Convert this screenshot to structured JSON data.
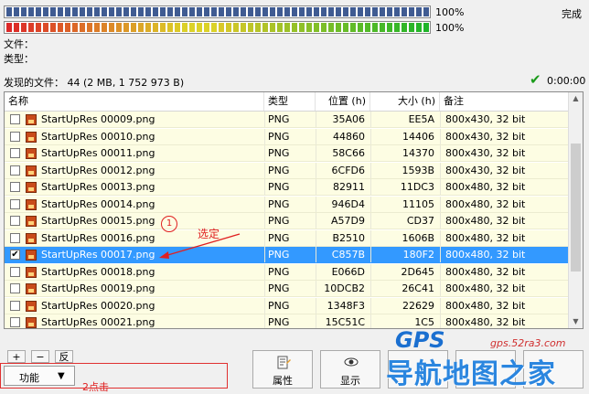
{
  "progress": {
    "bar1_percent": "100%",
    "bar2_percent": "100%",
    "status": "完成",
    "bar1_value": 1.0,
    "bar2_value": 1.0
  },
  "info": {
    "file_label": "文件：",
    "type_label": "类型：",
    "found": "发现的文件： 44 (2 MB, 1 752 973 B)",
    "timer": "0:00:00"
  },
  "table": {
    "headers": {
      "name": "名称",
      "type": "类型",
      "pos": "位置 (h)",
      "size": "大小 (h)",
      "note": "备注"
    },
    "rows": [
      {
        "name": "StartUpRes 00009.png",
        "type": "PNG",
        "pos": "35A06",
        "size": "EE5A",
        "note": "800x430, 32 bit",
        "checked": false,
        "selected": false
      },
      {
        "name": "StartUpRes 00010.png",
        "type": "PNG",
        "pos": "44860",
        "size": "14406",
        "note": "800x430, 32 bit",
        "checked": false,
        "selected": false
      },
      {
        "name": "StartUpRes 00011.png",
        "type": "PNG",
        "pos": "58C66",
        "size": "14370",
        "note": "800x430, 32 bit",
        "checked": false,
        "selected": false
      },
      {
        "name": "StartUpRes 00012.png",
        "type": "PNG",
        "pos": "6CFD6",
        "size": "1593B",
        "note": "800x430, 32 bit",
        "checked": false,
        "selected": false
      },
      {
        "name": "StartUpRes 00013.png",
        "type": "PNG",
        "pos": "82911",
        "size": "11DC3",
        "note": "800x480, 32 bit",
        "checked": false,
        "selected": false
      },
      {
        "name": "StartUpRes 00014.png",
        "type": "PNG",
        "pos": "946D4",
        "size": "11105",
        "note": "800x480, 32 bit",
        "checked": false,
        "selected": false
      },
      {
        "name": "StartUpRes 00015.png",
        "type": "PNG",
        "pos": "A57D9",
        "size": "CD37",
        "note": "800x480, 32 bit",
        "checked": false,
        "selected": false
      },
      {
        "name": "StartUpRes 00016.png",
        "type": "PNG",
        "pos": "B2510",
        "size": "1606B",
        "note": "800x480, 32 bit",
        "checked": false,
        "selected": false
      },
      {
        "name": "StartUpRes 00017.png",
        "type": "PNG",
        "pos": "C857B",
        "size": "180F2",
        "note": "800x480, 32 bit",
        "checked": true,
        "selected": true
      },
      {
        "name": "StartUpRes 00018.png",
        "type": "PNG",
        "pos": "E066D",
        "size": "2D645",
        "note": "800x480, 32 bit",
        "checked": false,
        "selected": false
      },
      {
        "name": "StartUpRes 00019.png",
        "type": "PNG",
        "pos": "10DCB2",
        "size": "26C41",
        "note": "800x480, 32 bit",
        "checked": false,
        "selected": false
      },
      {
        "name": "StartUpRes 00020.png",
        "type": "PNG",
        "pos": "1348F3",
        "size": "22629",
        "note": "800x480, 32 bit",
        "checked": false,
        "selected": false
      },
      {
        "name": "StartUpRes 00021.png",
        "type": "PNG",
        "pos": "15C51C",
        "size": "1C5",
        "note": "800x480, 32 bit",
        "checked": false,
        "selected": false
      }
    ]
  },
  "controls": {
    "plus": "+",
    "minus": "−",
    "invert": "反",
    "function": "功能",
    "properties": "属性",
    "show": "显示"
  },
  "annotations": {
    "circle1": "1",
    "selected_note": "选定",
    "click_note": "2点击"
  },
  "watermark": {
    "gps": "GPS",
    "url": "gps.52ra3.com",
    "cn": "导航地图之家"
  },
  "colors": {
    "selection": "#3399ff",
    "row_bg": "#fdfde3",
    "annotation": "#e02020"
  }
}
